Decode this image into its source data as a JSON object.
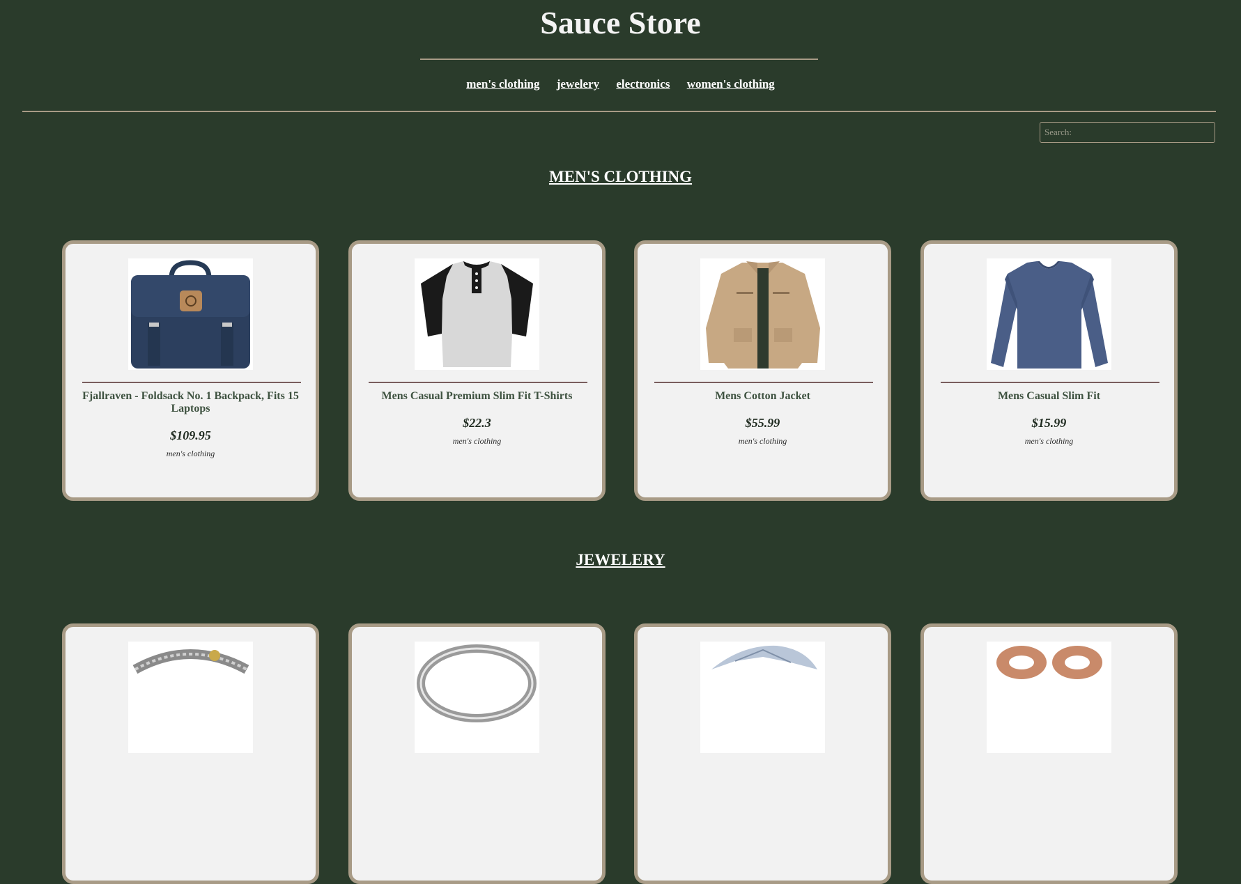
{
  "site": {
    "title": "Sauce Store"
  },
  "nav": {
    "items": [
      {
        "label": "men's clothing"
      },
      {
        "label": "jewelery"
      },
      {
        "label": "electronics"
      },
      {
        "label": "women's clothing"
      }
    ]
  },
  "search": {
    "placeholder": "Search:"
  },
  "sections": [
    {
      "heading": "MEN'S CLOTHING",
      "products": [
        {
          "name": "Fjallraven - Foldsack No. 1 Backpack, Fits 15 Laptops",
          "price": "$109.95",
          "category": "men's clothing",
          "image_icon": "backpack-image"
        },
        {
          "name": "Mens Casual Premium Slim Fit T-Shirts",
          "price": "$22.3",
          "category": "men's clothing",
          "image_icon": "tshirt-image"
        },
        {
          "name": "Mens Cotton Jacket",
          "price": "$55.99",
          "category": "men's clothing",
          "image_icon": "jacket-image"
        },
        {
          "name": "Mens Casual Slim Fit",
          "price": "$15.99",
          "category": "men's clothing",
          "image_icon": "longsleeve-image"
        }
      ]
    },
    {
      "heading": "JEWELERY",
      "products": [
        {
          "image_icon": "bracelet-image"
        },
        {
          "image_icon": "ring-image"
        },
        {
          "image_icon": "diamond-ring-image"
        },
        {
          "image_icon": "earrings-image"
        }
      ]
    }
  ],
  "colors": {
    "background": "#2a3b2b",
    "card": "#f2f2f2",
    "card_border": "#a89b86",
    "product_name": "#3e5240"
  }
}
